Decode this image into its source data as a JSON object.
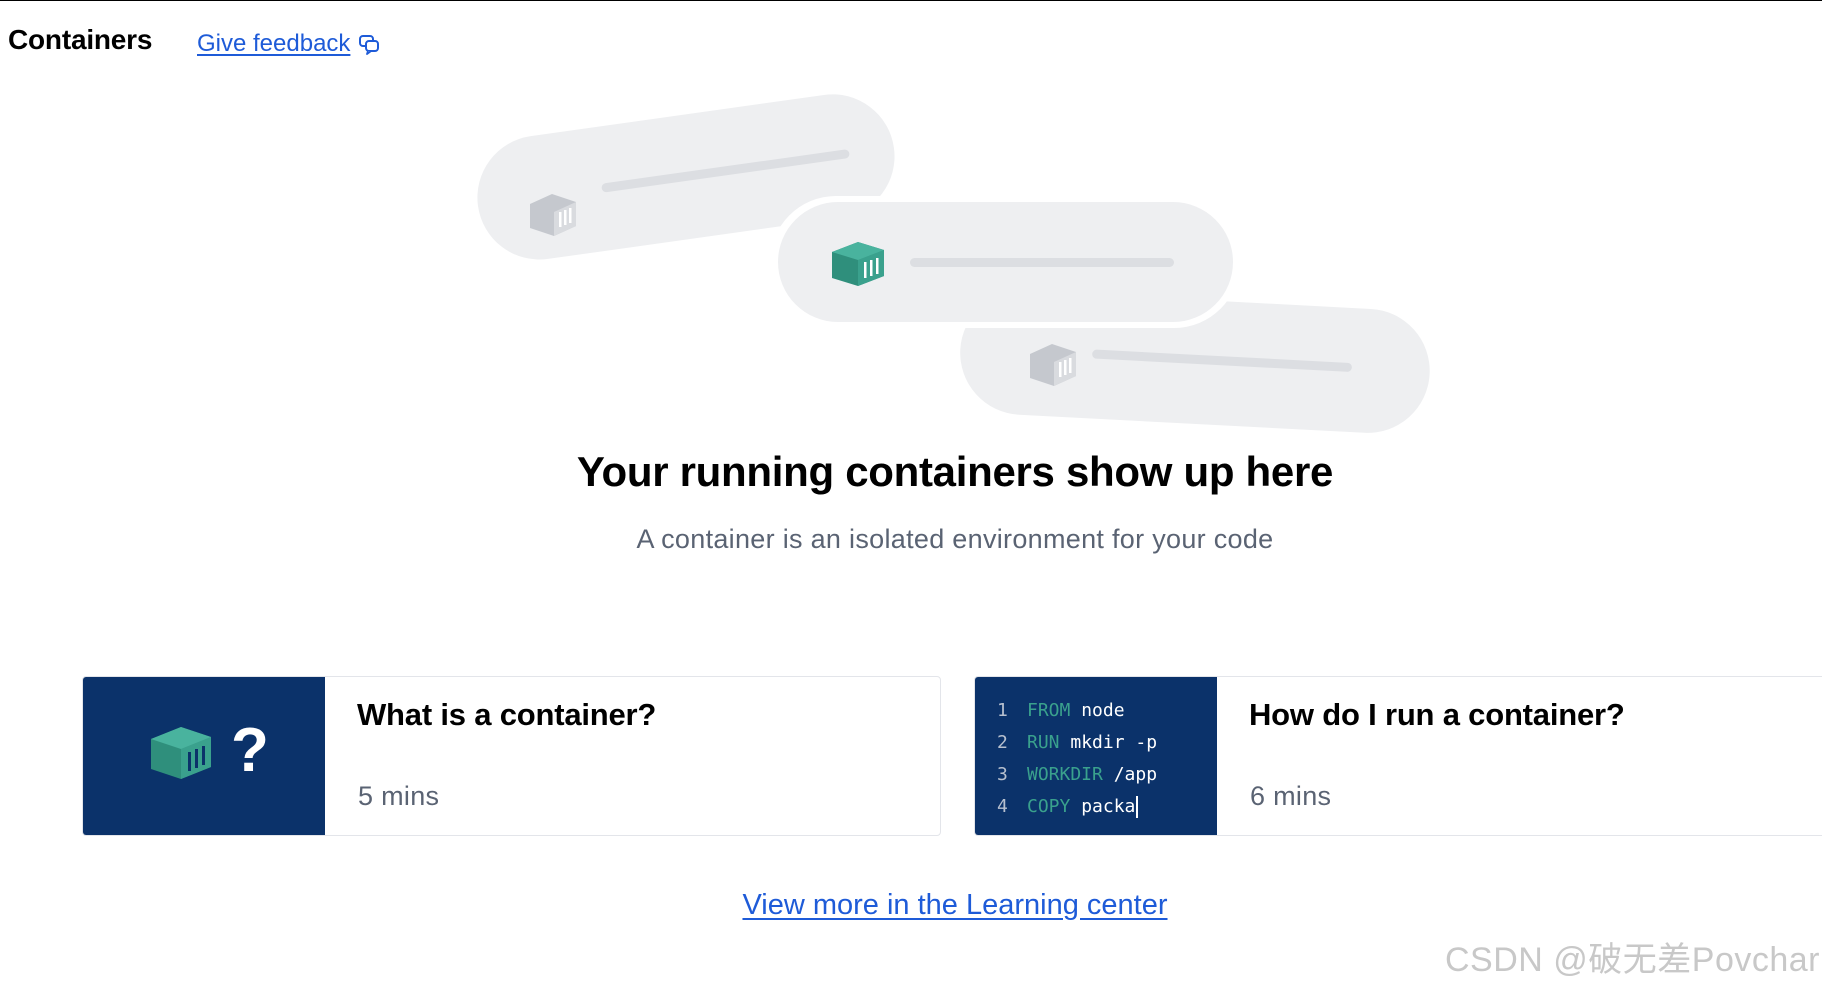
{
  "header": {
    "title": "Containers",
    "feedback_label": "Give feedback"
  },
  "empty_state": {
    "title": "Your running containers show up here",
    "subtitle": "A container is an isolated environment for your code"
  },
  "cards": [
    {
      "title": "What is a container?",
      "duration": "5 mins",
      "thumb_symbol": "?"
    },
    {
      "title": "How do I run a container?",
      "duration": "6 mins",
      "code_lines": [
        {
          "num": "1",
          "keyword": "FROM",
          "text": "node"
        },
        {
          "num": "2",
          "keyword": "RUN",
          "text": "mkdir -p"
        },
        {
          "num": "3",
          "keyword": "WORKDIR",
          "text": "/app"
        },
        {
          "num": "4",
          "keyword": "COPY",
          "text": "packa"
        }
      ]
    }
  ],
  "learning_link": "View more in the Learning center",
  "watermark": "CSDN @破无差Povchar",
  "colors": {
    "accent_link": "#1e5bd8",
    "card_thumb_bg": "#0b326a",
    "container_teal": "#3aa18d",
    "container_gray": "#c5c8ce",
    "placeholder_bg": "#eeeff1"
  },
  "icons": [
    "feedback-chat-icon",
    "container-cube-icon",
    "question-mark-icon"
  ]
}
